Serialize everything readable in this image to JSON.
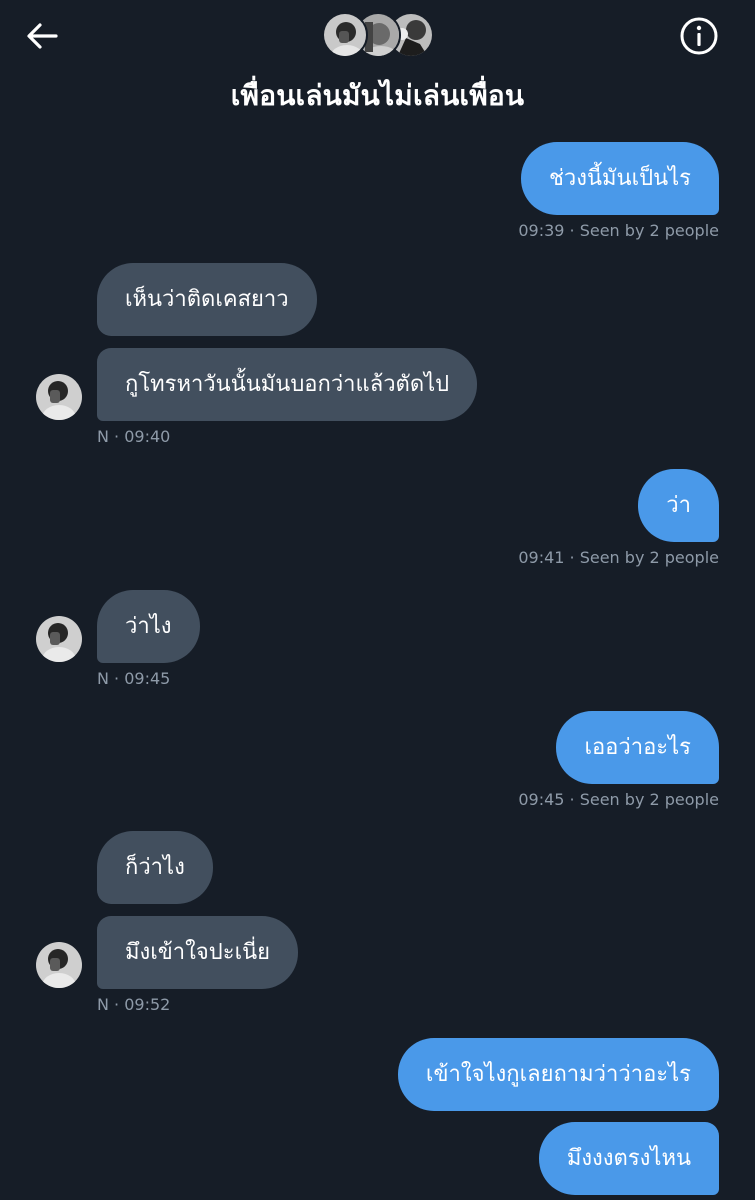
{
  "header": {
    "title": "เพื่อนเล่นมันไม่เล่นเพื่อน",
    "icons": {
      "back": "arrow-left-icon",
      "info": "info-circle-icon"
    },
    "avatar_count": 3
  },
  "colors": {
    "background": "#161d27",
    "outgoing_bubble": "#4a99e9",
    "incoming_bubble": "#424f5e",
    "meta_text": "#8e9aa8"
  },
  "messages": [
    {
      "dir": "out",
      "text": "ช่วงนี้มันเป็นไร"
    },
    {
      "dir": "out_meta",
      "time": "09:39",
      "seen": "Seen by 2 people"
    },
    {
      "dir": "in",
      "text": "เห็นว่าติดเคสยาว"
    },
    {
      "dir": "in",
      "text": "กูโทรหาวันนั้นมันบอกว่าแล้วตัดไป"
    },
    {
      "dir": "in_meta",
      "sender": "N",
      "time": "09:40"
    },
    {
      "dir": "out",
      "text": "ว่า"
    },
    {
      "dir": "out_meta",
      "time": "09:41",
      "seen": "Seen by 2 people"
    },
    {
      "dir": "in",
      "text": "ว่าไง"
    },
    {
      "dir": "in_meta",
      "sender": "N",
      "time": "09:45"
    },
    {
      "dir": "out",
      "text": "เออว่าอะไร"
    },
    {
      "dir": "out_meta",
      "time": "09:45",
      "seen": "Seen by 2 people"
    },
    {
      "dir": "in",
      "text": "ก็ว่าไง"
    },
    {
      "dir": "in",
      "text": "มึงเข้าใจปะเนี่ย"
    },
    {
      "dir": "in_meta",
      "sender": "N",
      "time": "09:52"
    },
    {
      "dir": "out",
      "text": "เข้าใจไงกูเลยถามว่าว่าอะไร"
    },
    {
      "dir": "out",
      "text": "มึงงงตรงไหน"
    }
  ],
  "msg_meta": {
    "m1": "09:39 · Seen by 2 people",
    "m2": "N · 09:40",
    "m3": "09:41 · Seen by 2 people",
    "m4": "N · 09:45",
    "m5": "09:45 · Seen by 2 people",
    "m6": "N · 09:52"
  }
}
